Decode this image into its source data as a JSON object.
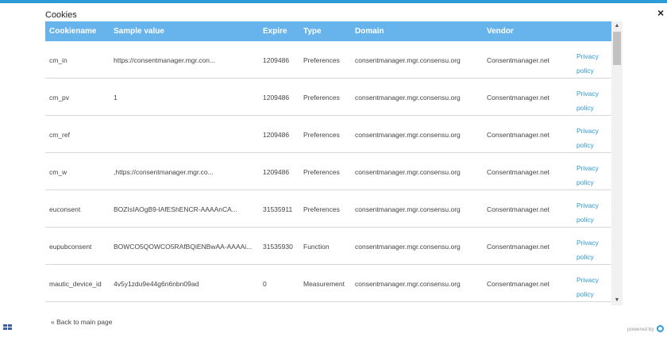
{
  "dialog": {
    "title": "Cookies",
    "close_label": "×",
    "back_link": "« Back to main page",
    "powered_by": "powered by"
  },
  "table": {
    "headers": {
      "name": "Cookiename",
      "sample": "Sample value",
      "expire": "Expire",
      "type": "Type",
      "domain": "Domain",
      "vendor": "Vendor"
    },
    "rows": [
      {
        "name": "cm_in",
        "sample": "https://consentmanager.mgr.con...",
        "expire": "1209486",
        "type": "Preferences",
        "domain": "consentmanager.mgr.consensu.org",
        "vendor": "Consentmanager.net",
        "link1": "Privacy",
        "link2": "policy"
      },
      {
        "name": "cm_pv",
        "sample": "1",
        "expire": "1209486",
        "type": "Preferences",
        "domain": "consentmanager.mgr.consensu.org",
        "vendor": "Consentmanager.net",
        "link1": "Privacy",
        "link2": "policy"
      },
      {
        "name": "cm_ref",
        "sample": "",
        "expire": "1209486",
        "type": "Preferences",
        "domain": "consentmanager.mgr.consensu.org",
        "vendor": "Consentmanager.net",
        "link1": "Privacy",
        "link2": "policy"
      },
      {
        "name": "cm_w",
        "sample": ",https://consentmanager.mgr.co...",
        "expire": "1209486",
        "type": "Preferences",
        "domain": "consentmanager.mgr.consensu.org",
        "vendor": "Consentmanager.net",
        "link1": "Privacy",
        "link2": "policy"
      },
      {
        "name": "euconsent",
        "sample": "BOZIsIAOgB9-lAfEShENCR-AAAAnCA...",
        "expire": "31535911",
        "type": "Preferences",
        "domain": "consentmanager.mgr.consensu.org",
        "vendor": "Consentmanager.net",
        "link1": "Privacy",
        "link2": "policy"
      },
      {
        "name": "eupubconsent",
        "sample": "BOWCO5QOWCO5RAfBQiENBwAA-AAAAi...",
        "expire": "31535930",
        "type": "Function",
        "domain": "consentmanager.mgr.consensu.org",
        "vendor": "Consentmanager.net",
        "link1": "Privacy",
        "link2": "policy"
      },
      {
        "name": "mautic_device_id",
        "sample": "4v5y1zdu9e44g6n6nbn09ad",
        "expire": "0",
        "type": "Measurement",
        "domain": "consentmanager.mgr.consensu.org",
        "vendor": "Consentmanager.net",
        "link1": "Privacy",
        "link2": "policy"
      }
    ]
  },
  "colors": {
    "accent": "#2e9ad8",
    "header_bg": "#67b4ec"
  }
}
